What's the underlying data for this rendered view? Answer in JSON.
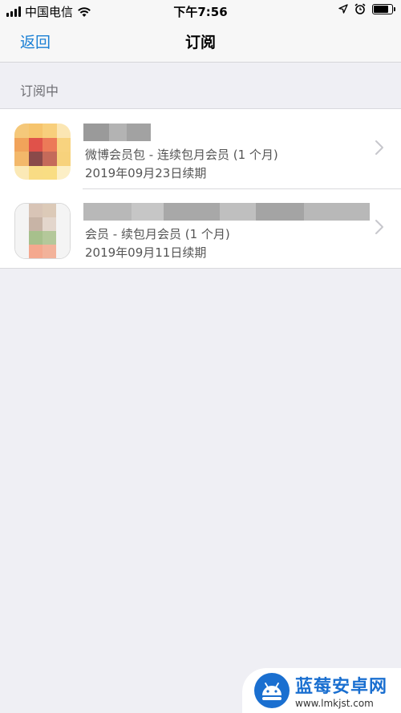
{
  "status_bar": {
    "carrier": "中国电信",
    "time": "下午7:56",
    "battery_level": 0.8
  },
  "nav": {
    "back_label": "返回",
    "title": "订阅"
  },
  "section": {
    "header": "订阅中"
  },
  "subscriptions": [
    {
      "subtitle": "微博会员包 - 连续包月会员 (1 个月)",
      "renewal": "2019年09月23日续期"
    },
    {
      "subtitle": "会员 - 续包月会员 (1 个月)",
      "renewal": "2019年09月11日续期"
    }
  ],
  "watermark": {
    "name": "蓝莓安卓网",
    "url": "www.lmkjst.com"
  },
  "colors": {
    "accent": "#1a7fd4",
    "background": "#efeff4",
    "bar": "#f7f7f7",
    "secondary_text": "#555555"
  }
}
